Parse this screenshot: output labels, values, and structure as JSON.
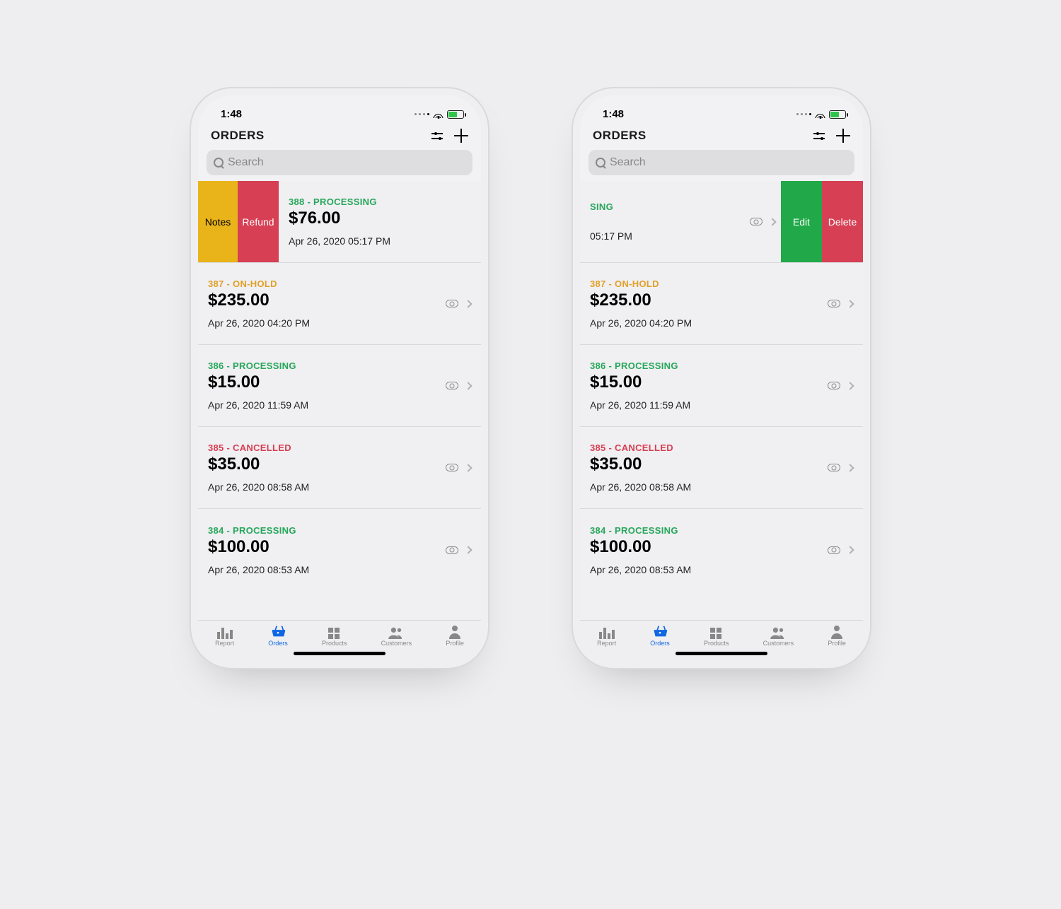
{
  "status_time": "1:48",
  "header": {
    "title": "ORDERS"
  },
  "search": {
    "placeholder": "Search"
  },
  "orders": [
    {
      "status": "388 - PROCESSING",
      "amount": "$76.00",
      "date": "Apr 26, 2020 05:17 PM",
      "cls": "c-processing"
    },
    {
      "status": "387 - ON-HOLD",
      "amount": "$235.00",
      "date": "Apr 26, 2020 04:20 PM",
      "cls": "c-onhold"
    },
    {
      "status": "386 - PROCESSING",
      "amount": "$15.00",
      "date": "Apr 26, 2020 11:59 AM",
      "cls": "c-processing"
    },
    {
      "status": "385 - CANCELLED",
      "amount": "$35.00",
      "date": "Apr 26, 2020 08:58 AM",
      "cls": "c-cancelled"
    },
    {
      "status": "384 - PROCESSING",
      "amount": "$100.00",
      "date": "Apr 26, 2020 08:53 AM",
      "cls": "c-processing"
    }
  ],
  "b_first": {
    "status": "SING",
    "date": "05:17 PM"
  },
  "swipeA": {
    "notes": "Notes",
    "refund": "Refund"
  },
  "swipeB": {
    "edit": "Edit",
    "delete": "Delete"
  },
  "tabs": {
    "report": "Report",
    "orders": "Orders",
    "products": "Products",
    "customers": "Customers",
    "profile": "Profile"
  }
}
